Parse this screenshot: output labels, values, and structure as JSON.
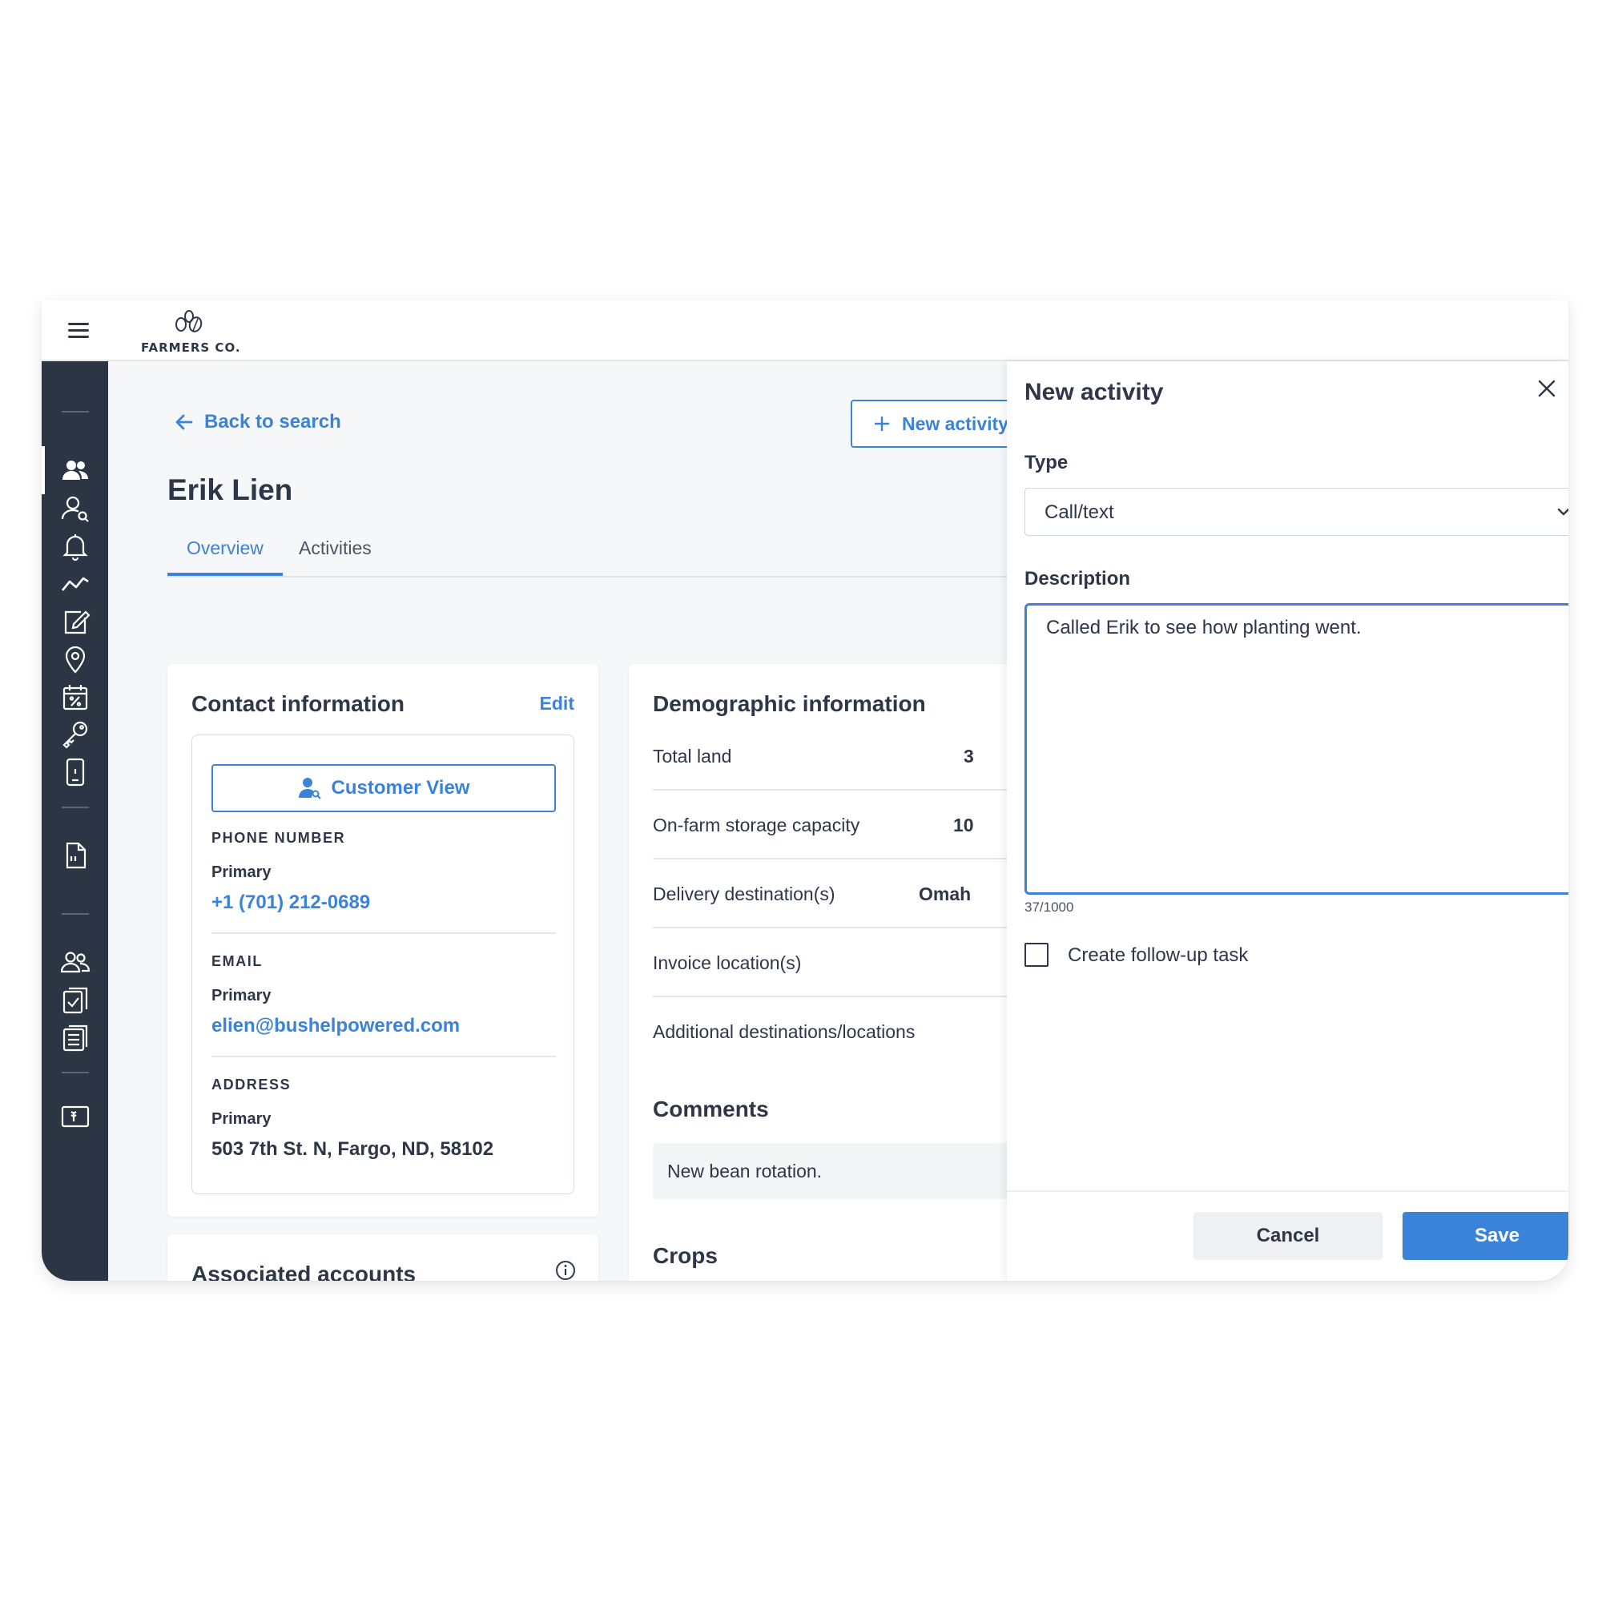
{
  "app": {
    "logo_text": "FARMERS CO."
  },
  "nav": {
    "back_label": "Back to search",
    "new_activity_label": "New activity"
  },
  "customer": {
    "name": "Erik Lien"
  },
  "tabs": [
    {
      "label": "Overview",
      "active": true
    },
    {
      "label": "Activities",
      "active": false
    }
  ],
  "contact": {
    "title": "Contact information",
    "edit_label": "Edit",
    "customer_view_label": "Customer View",
    "phone": {
      "label": "PHONE NUMBER",
      "type": "Primary",
      "value": "+1 (701) 212-0689"
    },
    "email": {
      "label": "EMAIL",
      "type": "Primary",
      "value": "elien@bushelpowered.com"
    },
    "address": {
      "label": "ADDRESS",
      "type": "Primary",
      "value": "503 7th St. N, Fargo, ND, 58102"
    }
  },
  "associated_accounts": {
    "title": "Associated accounts"
  },
  "demographic": {
    "title": "Demographic information",
    "rows": [
      {
        "label": "Total land",
        "value": "3"
      },
      {
        "label": "On-farm storage capacity",
        "value": "10"
      },
      {
        "label": "Delivery destination(s)",
        "value": "Omah"
      },
      {
        "label": "Invoice location(s)",
        "value": ""
      },
      {
        "label": "Additional destinations/locations",
        "value": ""
      }
    ],
    "comments_title": "Comments",
    "comment": "New bean rotation.",
    "crops_title": "Crops"
  },
  "panel": {
    "title": "New activity",
    "type_label": "Type",
    "type_value": "Call/text",
    "description_label": "Description",
    "description_value": "Called Erik to see how planting went.",
    "char_count": "37/1000",
    "followup_label": "Create follow-up task",
    "followup_checked": false,
    "cancel_label": "Cancel",
    "save_label": "Save"
  },
  "colors": {
    "accent": "#3b82d9",
    "sidebar": "#2b3544",
    "text": "#2d3748"
  }
}
